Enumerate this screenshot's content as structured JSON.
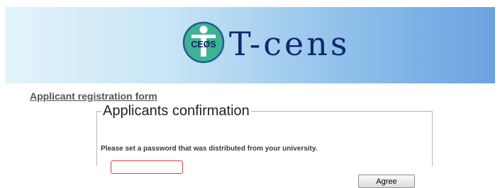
{
  "header": {
    "logo_badge_text": "CEØS",
    "site_name": "T-cens"
  },
  "breadcrumb_link": "Applicant registration form",
  "confirm": {
    "legend": "Applicants confirmation",
    "instruction": "Please set a password that was distributed from your university.",
    "password_value": "",
    "agree_label": "Agree"
  },
  "colors": {
    "banner_left": "#e3f4fb",
    "banner_right": "#6aa3e2",
    "logo_text": "#13276f",
    "logo_circle": "#3fb294",
    "input_border_error": "#e03f3f"
  },
  "icons": {
    "logo": "t-cens-logo-icon"
  }
}
